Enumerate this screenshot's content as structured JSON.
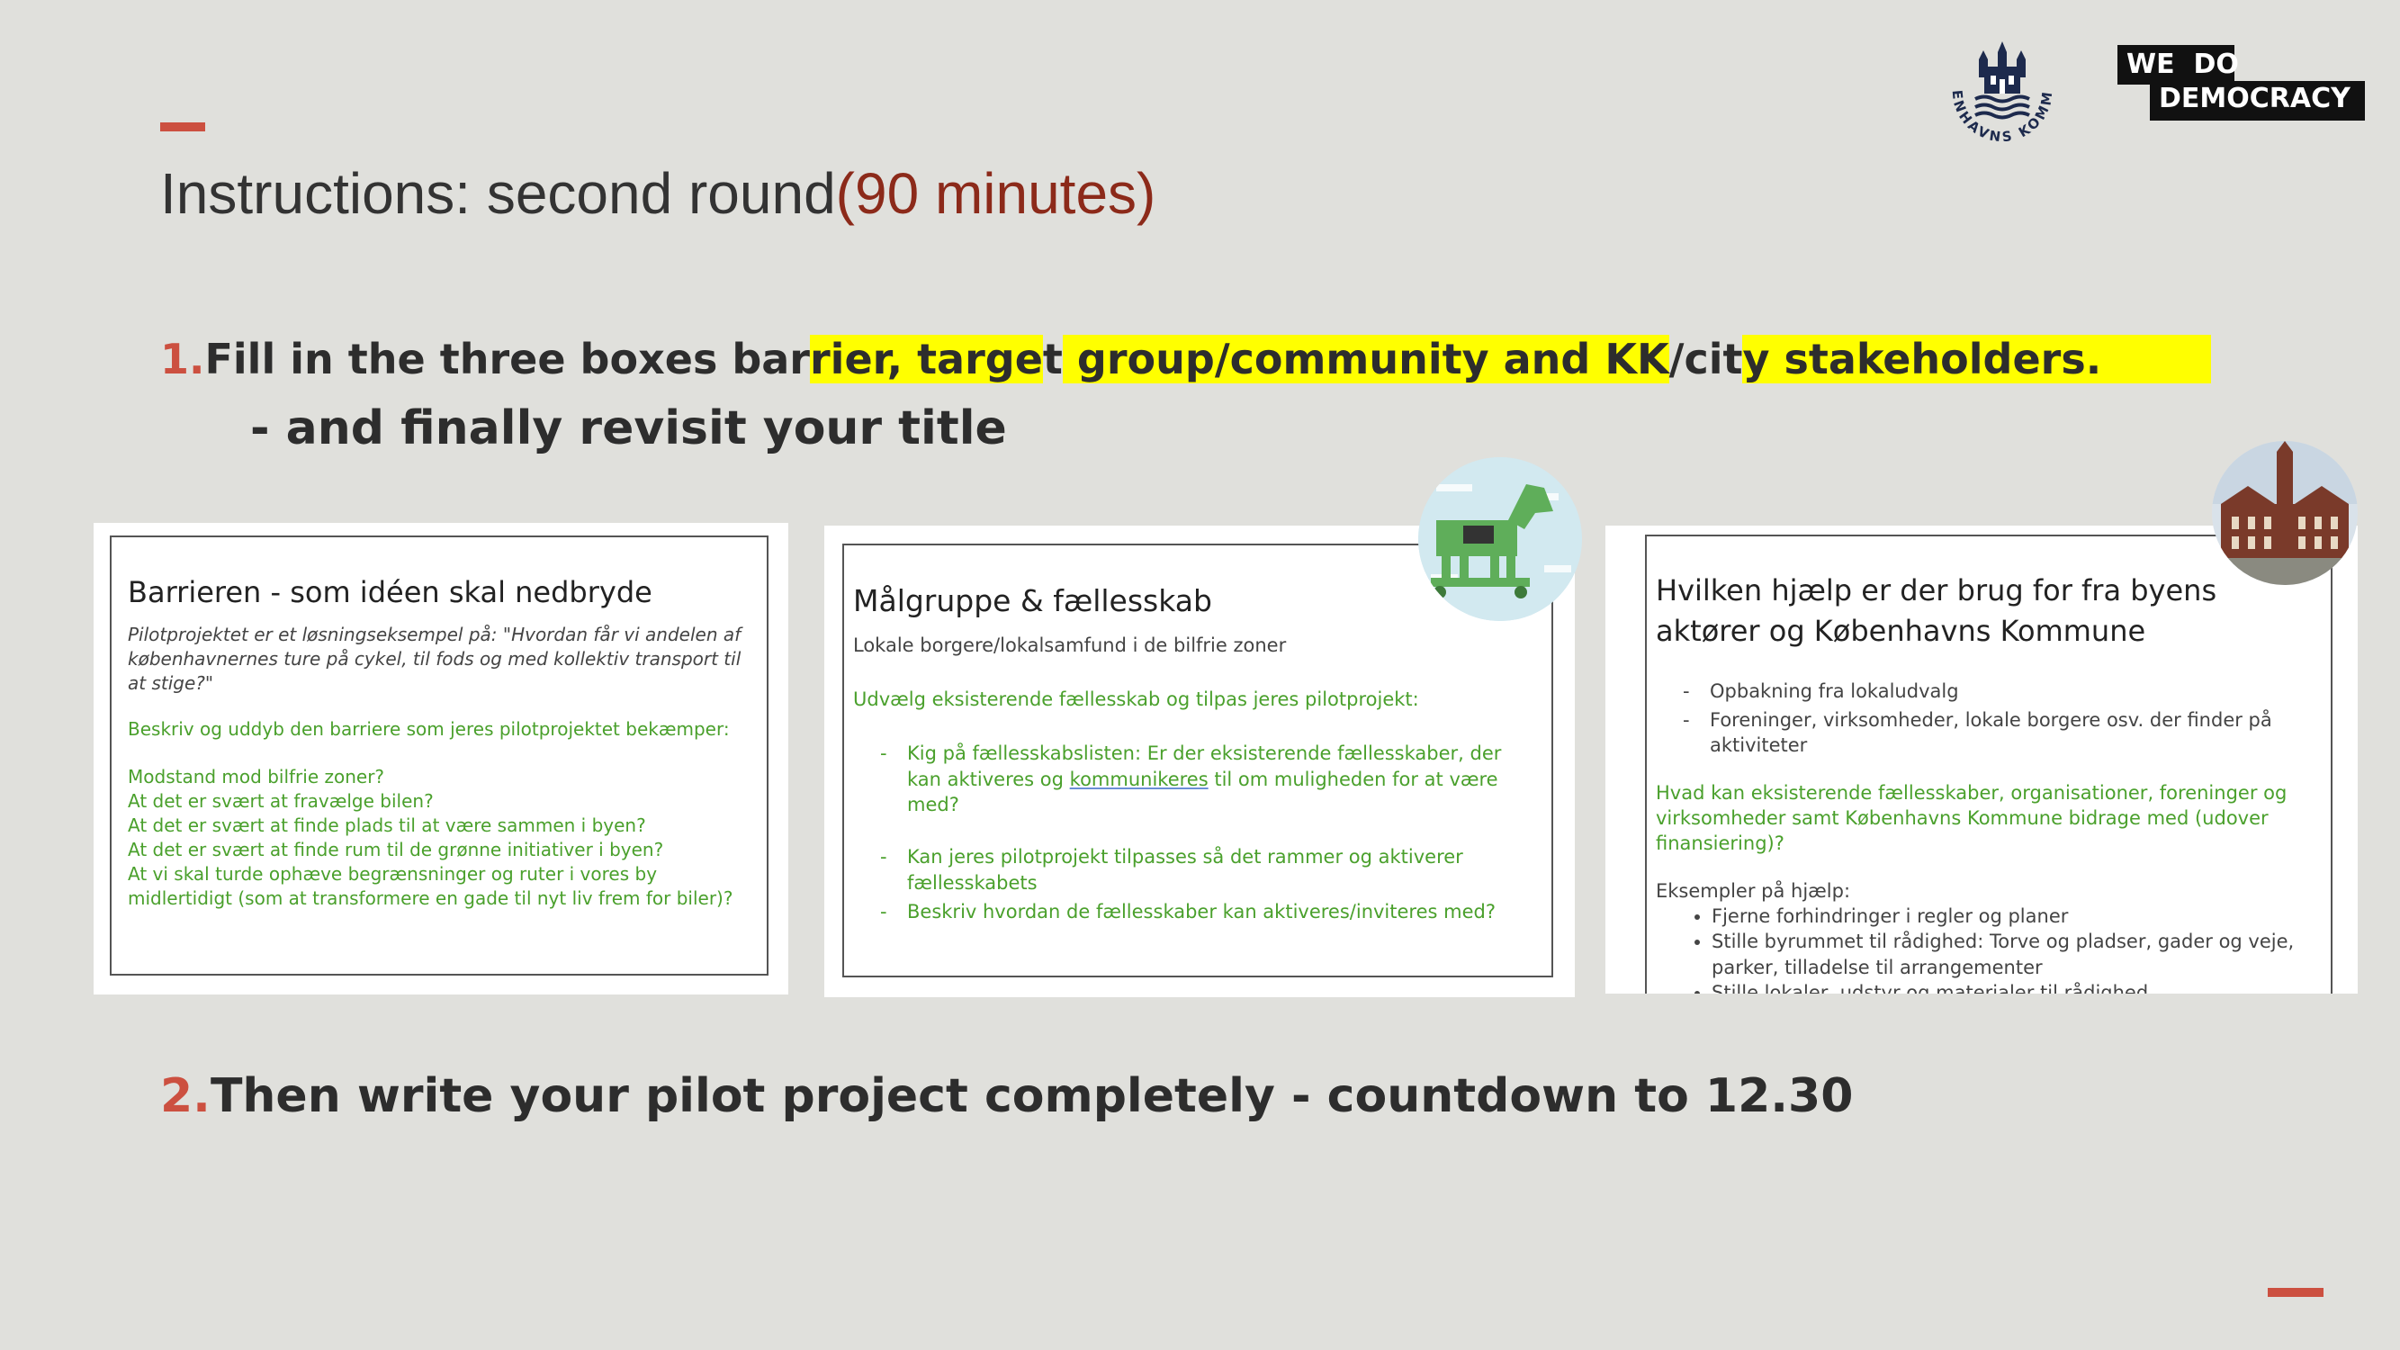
{
  "header": {
    "title": "Instructions: second round",
    "duration": "(90 minutes)",
    "logos": {
      "kommune": "KØBENHAVNS KOMMUNE",
      "wedo_line1": "WE  DO",
      "wedo_line2": "DEMOCRACY"
    }
  },
  "step1": {
    "num": "1.",
    "text_a": "Fill in the three boxes bar",
    "text_b": "rier, targe",
    "text_c": "t",
    "text_d": " group/community and KK",
    "text_e": "/cit",
    "text_f": "y stakeholders.",
    "sub": "- and finally revisit your title"
  },
  "cards": {
    "barrier": {
      "title": "Barrieren - som idéen skal nedbryde",
      "intro": "Pilotprojektet er et løsningseksempel på: \"Hvordan får vi andelen af københavnernes ture på cykel, til fods og med kollektiv transport til at stige?\"",
      "prompt": "Beskriv og uddyb den barriere som jeres pilotprojektet bekæmper:",
      "lines": [
        "Modstand mod bilfrie zoner?",
        "At det er svært at fravælge bilen?",
        "At det er svært at finde plads til at være sammen i byen?",
        "At det er svært at finde rum til de grønne initiativer i byen?",
        "At vi skal turde ophæve begrænsninger og ruter i vores by midlertidigt (som at transformere en gade til nyt liv frem for biler)?"
      ]
    },
    "target": {
      "title": "Målgruppe & fællesskab",
      "subtitle": "Lokale borgere/lokalsamfund i de bilfrie zoner",
      "prompt": "Udvælg eksisterende fællesskab og tilpas jeres pilotprojekt:",
      "item1_a": "Kig på fællesskabslisten: Er der eksisterende fællesskaber, der kan aktiveres og ",
      "item1_link": "kommunikeres",
      "item1_b": " til om muligheden for at være med?",
      "item2": "Kan jeres pilotprojekt tilpasses så det rammer og aktiverer fællesskabets",
      "item3": "Beskriv hvordan de fællesskaber kan aktiveres/inviteres med?"
    },
    "help": {
      "title": "Hvilken hjælp er der brug for fra byens aktører og Københavns Kommune",
      "dash_items": [
        "Opbakning fra lokaludvalg",
        "Foreninger, virksomheder, lokale borgere osv. der finder på aktiviteter"
      ],
      "prompt": "Hvad kan eksisterende fællesskaber, organisationer, foreninger og virksomheder samt Københavns Kommune bidrage med (udover finansiering)?",
      "examples_label": "Eksempler på hjælp:",
      "bullets": [
        "Fjerne forhindringer i regler og planer",
        "Stille byrummet til rådighed: Torve og pladser, gader og veje, parker, tilladelse til arrangementer",
        "Stille lokaler, udstyr og materialer til rådighed"
      ]
    }
  },
  "step2": {
    "num": "2.",
    "text": "Then write your pilot project completely - countdown to 12.30"
  },
  "colors": {
    "accent": "#cc5040",
    "title_duration": "#8c2a1a",
    "highlight": "#ffff00",
    "card_green": "#4aa02c",
    "background": "#e0e0dc"
  }
}
